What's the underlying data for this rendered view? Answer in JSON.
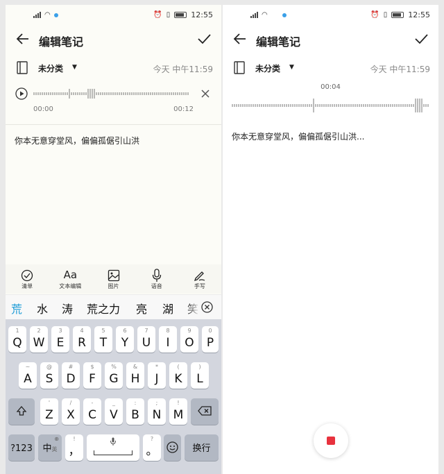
{
  "status_time": "12:55",
  "left_screen": {
    "title": "编辑笔记",
    "category": "未分类",
    "date": "今天 中午11:59",
    "player": {
      "time_start": "00:00",
      "time_end": "00:12"
    },
    "note_text": "你本无意穿堂风，偏偏孤倨引山洪",
    "toolbar": [
      {
        "label": "清单",
        "icon": "checklist-icon"
      },
      {
        "label": "文本编辑",
        "icon": "text-format-icon"
      },
      {
        "label": "图片",
        "icon": "image-icon"
      },
      {
        "label": "语音",
        "icon": "microphone-icon"
      },
      {
        "label": "手写",
        "icon": "handwriting-icon"
      }
    ],
    "format_glyph": "Aa",
    "candidates": [
      "荒",
      "水",
      "涛",
      "荒之力",
      "亮",
      "湖",
      "笑"
    ],
    "keyboard": {
      "row1": [
        {
          "main": "Q",
          "sub": "1"
        },
        {
          "main": "W",
          "sub": "2"
        },
        {
          "main": "E",
          "sub": "3"
        },
        {
          "main": "R",
          "sub": "4"
        },
        {
          "main": "T",
          "sub": "5"
        },
        {
          "main": "Y",
          "sub": "6"
        },
        {
          "main": "U",
          "sub": "7"
        },
        {
          "main": "I",
          "sub": "8"
        },
        {
          "main": "O",
          "sub": "9"
        },
        {
          "main": "P",
          "sub": "0"
        }
      ],
      "row2": [
        {
          "main": "A",
          "sub": "~"
        },
        {
          "main": "S",
          "sub": "@"
        },
        {
          "main": "D",
          "sub": "#"
        },
        {
          "main": "F",
          "sub": "$"
        },
        {
          "main": "G",
          "sub": "%"
        },
        {
          "main": "H",
          "sub": "&"
        },
        {
          "main": "J",
          "sub": "*"
        },
        {
          "main": "K",
          "sub": "("
        },
        {
          "main": "L",
          "sub": ")"
        }
      ],
      "row3": [
        {
          "main": "Z",
          "sub": "'"
        },
        {
          "main": "X",
          "sub": "/"
        },
        {
          "main": "C",
          "sub": "-"
        },
        {
          "main": "V",
          "sub": "_"
        },
        {
          "main": "B",
          "sub": ":"
        },
        {
          "main": "N",
          "sub": ";"
        },
        {
          "main": "M",
          "sub": "!"
        }
      ],
      "num_key": "?123",
      "lang_key": "中",
      "lang_key_sub": "英",
      "comma_key": "，",
      "comma_sub": "!",
      "period_key": "。",
      "period_sub": "?",
      "enter_key": "换行"
    }
  },
  "right_screen": {
    "title": "编辑笔记",
    "category": "未分类",
    "date": "今天 中午11:59",
    "recording_time": "00:04",
    "note_text": "你本无意穿堂风，偏偏孤倨引山洪..."
  },
  "colors": {
    "accent": "#1a9ad6",
    "record_red": "#e8323e",
    "background": "#fcfcf7",
    "keyboard": "#d3d6de"
  }
}
